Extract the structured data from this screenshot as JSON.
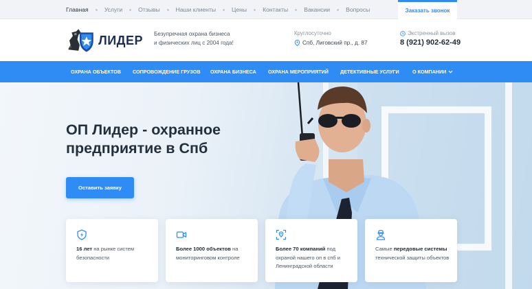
{
  "top_nav": {
    "items": [
      "Главная",
      "Услуги",
      "Отзывы",
      "Наши клиенты",
      "Цены",
      "Контакты",
      "Вакансии",
      "Вопросы"
    ],
    "active_index": 0,
    "callback_label": "Заказать звонок"
  },
  "header": {
    "logo_text": "ЛИДЕР",
    "tagline_line1": "Безупречная охрана бизнеса",
    "tagline_line2": "и физических лиц с 2004 года!",
    "hours": "Круглосуточно",
    "address": "Спб, Лиговский пр., д. 87",
    "emergency_label": "Экстренный вызов",
    "phone": "8 (921) 902-62-49"
  },
  "main_nav": {
    "items": [
      "ОХРАНА ОБЪЕКТОВ",
      "СОПРОВОЖДЕНИЕ ГРУЗОВ",
      "ОХРАНА БИЗНЕСА",
      "ОХРАНА МЕРОПРИЯТИЙ",
      "ДЕТЕКТИВНЫЕ УСЛУГИ",
      "О КОМПАНИИ"
    ]
  },
  "hero": {
    "title_line1": "ОП Лидер - охранное",
    "title_line2": "предприятие в Спб",
    "cta_label": "Оставить заявку"
  },
  "features": [
    {
      "icon": "shield-lightning-icon",
      "strong": "16 лет",
      "rest": " на рынке систем безопасности"
    },
    {
      "icon": "video-camera-icon",
      "strong": "Более 1000 объектов",
      "rest": " на мониторинговом контроле"
    },
    {
      "icon": "location-frame-icon",
      "strong": "Более 70 компаний",
      "rest": " под охраной нашего оп в спб и Ленинградской области"
    },
    {
      "icon": "security-guard-icon",
      "lead": "Самые ",
      "strong": "передовые системы",
      "rest": " технической защиты объектов"
    }
  ],
  "colors": {
    "accent": "#2f8cf5",
    "topbar_bg": "#f1f3f6",
    "title": "#22303d"
  }
}
